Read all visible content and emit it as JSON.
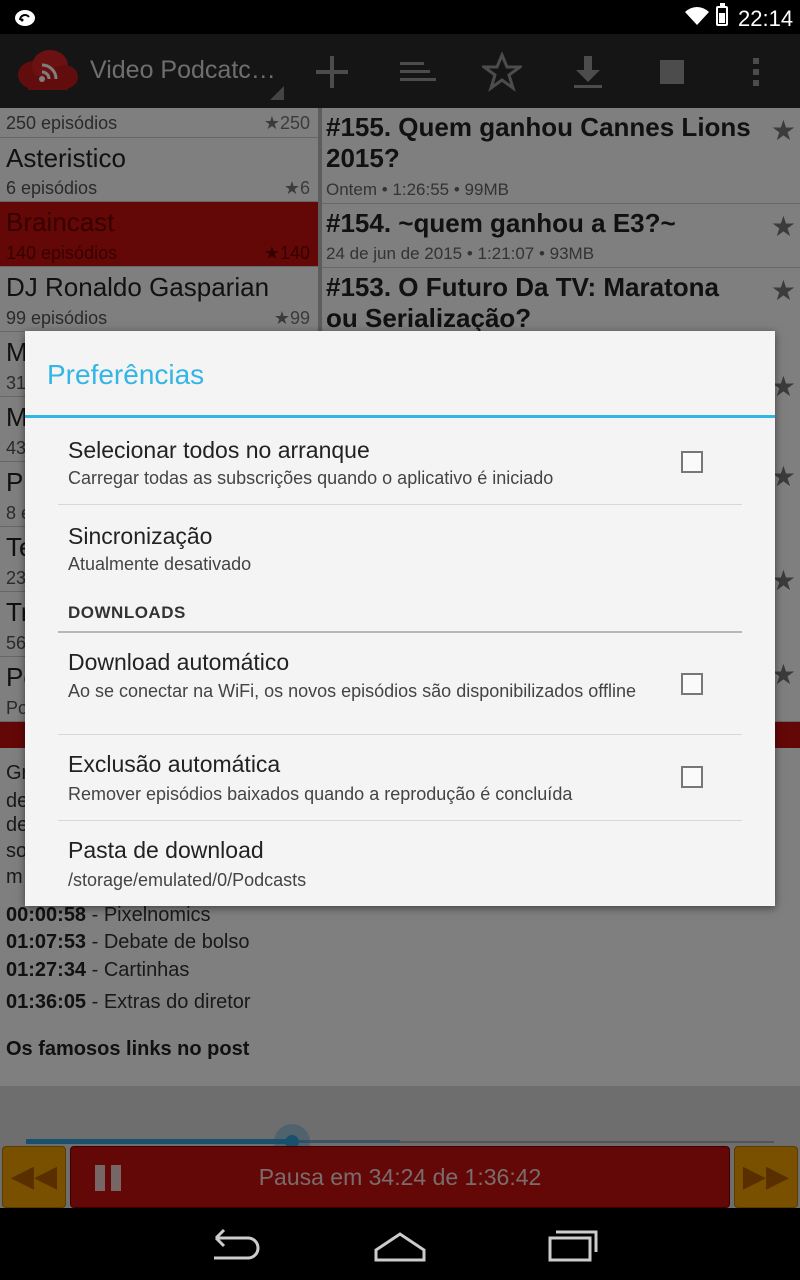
{
  "status_bar": {
    "time": "22:14"
  },
  "action_bar": {
    "title": "Video Podcatc…",
    "icons": [
      "add-icon",
      "sort-icon",
      "star-icon",
      "download-icon",
      "stop-icon",
      "overflow-menu-icon"
    ]
  },
  "podcasts": [
    {
      "name": "",
      "count": "250 episódios",
      "stars": "★250",
      "selected": false
    },
    {
      "name": "Asteristico",
      "count": "6 episódios",
      "stars": "★6",
      "selected": false
    },
    {
      "name": "Braincast",
      "count": "140 episódios",
      "stars": "★140",
      "selected": true
    },
    {
      "name": "DJ Ronaldo Gasparian",
      "count": "99 episódios",
      "stars": "★99",
      "selected": false
    },
    {
      "name": "M",
      "count": "31",
      "stars": "",
      "selected": false
    },
    {
      "name": "M",
      "count": "43",
      "stars": "",
      "selected": false
    },
    {
      "name": "P",
      "count": "8 e",
      "stars": "",
      "selected": false
    },
    {
      "name": "Te",
      "count": "23",
      "stars": "",
      "selected": false
    },
    {
      "name": "Tr",
      "count": "56",
      "stars": "",
      "selected": false
    },
    {
      "name": "Po",
      "count": "Po",
      "stars": "",
      "selected": false
    }
  ],
  "episodes": [
    {
      "title": "#155. Quem ganhou Cannes Lions 2015?",
      "meta": "Ontem • 1:26:55 • 99MB"
    },
    {
      "title": "#154. ~quem ganhou a E3?~",
      "meta": "24 de jun de 2015 • 1:21:07 • 93MB"
    },
    {
      "title": "#153. O Futuro Da TV: Maratona ou Serialização?",
      "meta": ""
    }
  ],
  "notes": {
    "fragments": [
      "Gr",
      "de",
      "de",
      "so",
      "m"
    ],
    "chapters": [
      {
        "time": "00:00:58",
        "label": " - Pixelnomics"
      },
      {
        "time": "01:07:53",
        "label": " - Debate de bolso"
      },
      {
        "time": "01:27:34",
        "label": " - Cartinhas"
      },
      {
        "time": "01:36:05",
        "label": " - Extras do diretor"
      }
    ],
    "links_heading": "Os famosos links no post"
  },
  "player": {
    "label": "Pausa em 34:24 de 1:36:42",
    "progress": 0.356,
    "buffered": 0.5
  },
  "dialog": {
    "title": "Preferências",
    "prefs": {
      "select_all": {
        "title": "Selecionar todos no arranque",
        "summary": "Carregar todas as subscrições quando o aplicativo é iniciado",
        "checked": false
      },
      "sync": {
        "title": "Sincronização",
        "summary": "Atualmente desativado"
      },
      "auto_download": {
        "title": "Download automático",
        "summary": "Ao se conectar na WiFi, os novos episódios são disponibilizados offline",
        "checked": false
      },
      "auto_delete": {
        "title": "Exclusão automática",
        "summary": "Remover episódios baixados quando a reprodução é concluída",
        "checked": false
      },
      "download_folder": {
        "title": "Pasta de download",
        "summary": "/storage/emulated/0/Podcasts"
      }
    },
    "category_downloads": "DOWNLOADS"
  },
  "colors": {
    "accent": "#33b5e5",
    "brand_red": "#c80f0f",
    "skip_orange": "#f0a000"
  }
}
